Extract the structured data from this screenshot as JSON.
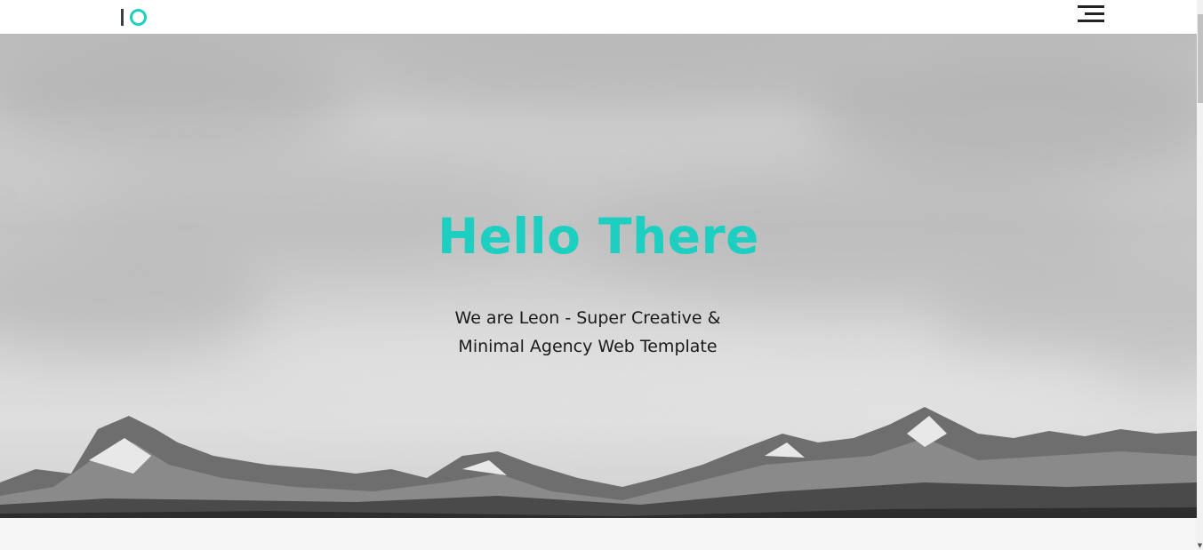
{
  "header": {
    "logo_icon": "io-logo-icon",
    "menu_icon": "hamburger-menu-icon"
  },
  "hero": {
    "title": "Hello There",
    "subtitle": "We are Leon - Super Creative & Minimal Agency Web Template",
    "background": "mountain-landscape-photo"
  },
  "colors": {
    "accent": "#1ccfc0",
    "text_dark": "#1a1a1a",
    "header_bg": "#ffffff",
    "section_bg": "#f5f5f5"
  },
  "scrollbar": {
    "arrow_icon": "scroll-down-arrow-icon"
  }
}
